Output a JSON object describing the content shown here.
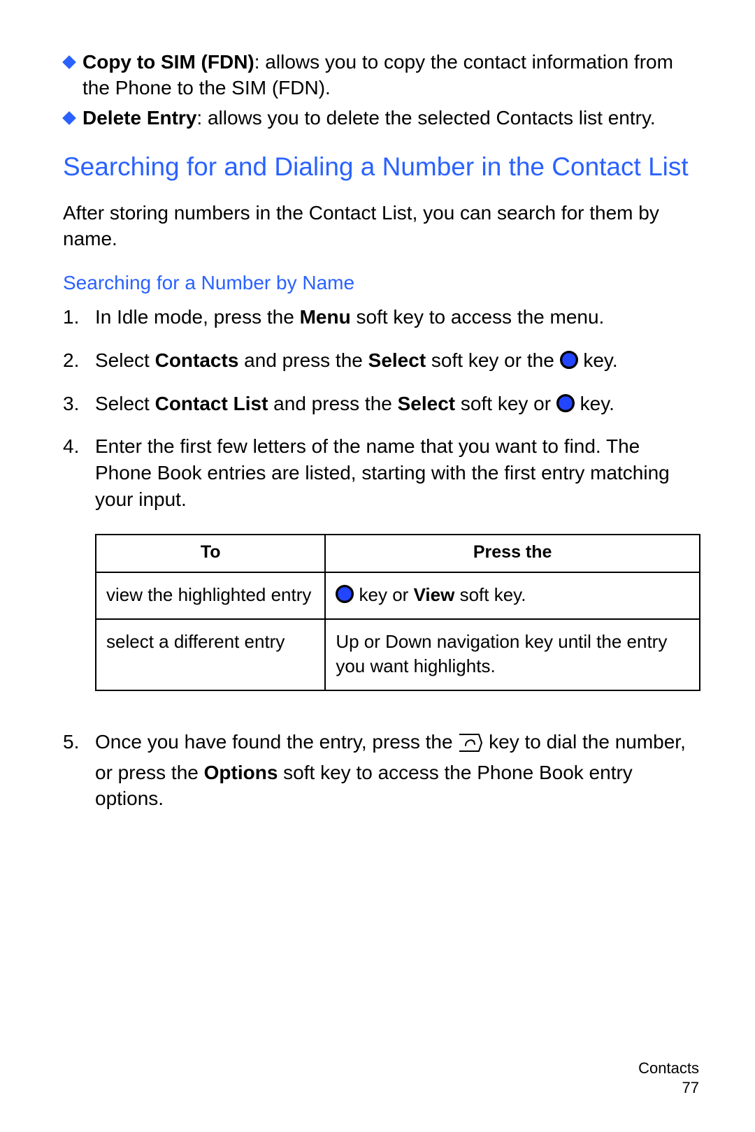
{
  "bullets": [
    {
      "term": "Copy to SIM (FDN)",
      "desc": ": allows you to copy the contact information from the Phone to the SIM (FDN)."
    },
    {
      "term": "Delete Entry",
      "desc": ": allows you to delete the selected Contacts list entry."
    }
  ],
  "h1": "Searching for and Dialing a Number in the Contact List",
  "intro": "After storing numbers in the Contact List, you can search for them by name.",
  "h2": "Searching for a Number by Name",
  "steps": {
    "s1": {
      "num": "1.",
      "a": "In Idle mode, press the ",
      "b": "Menu",
      "c": " soft key to access the menu."
    },
    "s2": {
      "num": "2.",
      "a": "Select ",
      "b": "Contacts",
      "c": " and press the ",
      "d": "Select",
      "e": " soft key or the ",
      "f": " key."
    },
    "s3": {
      "num": "3.",
      "a": "Select ",
      "b": "Contact List",
      "c": " and press the ",
      "d": "Select",
      "e": " soft key or ",
      "f": " key."
    },
    "s4": {
      "num": "4.",
      "text": "Enter the first few letters of the name that you want to find. The Phone Book entries are listed, starting with the first entry matching your input."
    },
    "s5": {
      "num": "5.",
      "a": "Once you have found the entry, press the ",
      "b": " key to dial the number, or press the ",
      "c": "Options",
      "d": " soft key to access the Phone Book entry options."
    }
  },
  "table": {
    "head": {
      "c1": "To",
      "c2": "Press the"
    },
    "rows": [
      {
        "c1": "view the highlighted entry",
        "c2a": " key or ",
        "c2b": "View",
        "c2c": " soft key."
      },
      {
        "c1": "select a different entry",
        "c2": "Up or Down navigation key until the entry you want highlights."
      }
    ]
  },
  "footer": {
    "section": "Contacts",
    "page": "77"
  }
}
